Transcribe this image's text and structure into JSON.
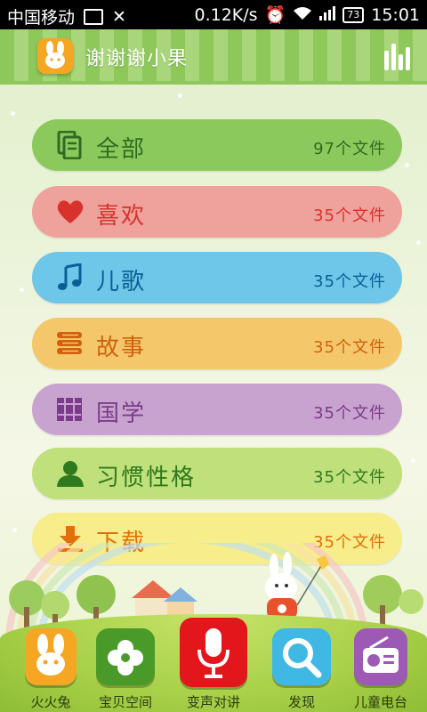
{
  "status_bar": {
    "carrier": "中国移动",
    "speed": "0.12K/s",
    "battery": "73",
    "time": "15:01"
  },
  "header": {
    "title": "谢谢谢小果",
    "logo_icon": "rabbit-logo-icon",
    "menu_icon": "equalizer-icon"
  },
  "categories": [
    {
      "label": "全部",
      "count": "97个文件",
      "icon": "documents-icon",
      "bg": "#8cc95c",
      "text_color": "#2f6b20",
      "count_color": "#2f6b20"
    },
    {
      "label": "喜欢",
      "count": "35个文件",
      "icon": "heart-icon",
      "bg": "#efa19c",
      "text_color": "#d8322c",
      "count_color": "#d8322c"
    },
    {
      "label": "儿歌",
      "count": "35个文件",
      "icon": "music-note-icon",
      "bg": "#6ec6e8",
      "text_color": "#0a5f96",
      "count_color": "#0a5f96"
    },
    {
      "label": "故事",
      "count": "35个文件",
      "icon": "book-stack-icon",
      "bg": "#f4c86a",
      "text_color": "#d2600e",
      "count_color": "#d2600e"
    },
    {
      "label": "国学",
      "count": "35个文件",
      "icon": "bookshelf-icon",
      "bg": "#c9a3cf",
      "text_color": "#7b3b8a",
      "count_color": "#7b3b8a"
    },
    {
      "label": "习惯性格",
      "count": "35个文件",
      "icon": "person-icon",
      "bg": "#bfe07a",
      "text_color": "#2f7a1e",
      "count_color": "#2f7a1e"
    },
    {
      "label": "下载",
      "count": "35个文件",
      "icon": "download-icon",
      "bg": "#f7ed8a",
      "text_color": "#e26f0a",
      "count_color": "#e26f0a"
    }
  ],
  "bottom_tabs": [
    {
      "label": "火火兔",
      "icon": "rabbit-icon",
      "bg": "#f5a623"
    },
    {
      "label": "宝贝空间",
      "icon": "clover-icon",
      "bg": "#4a9a2a"
    },
    {
      "label": "变声对讲",
      "icon": "microphone-icon",
      "bg": "#e3161c"
    },
    {
      "label": "发现",
      "icon": "magnifier-icon",
      "bg": "#3fb9e3"
    },
    {
      "label": "儿童电台",
      "icon": "radio-icon",
      "bg": "#9d5ab5"
    }
  ]
}
